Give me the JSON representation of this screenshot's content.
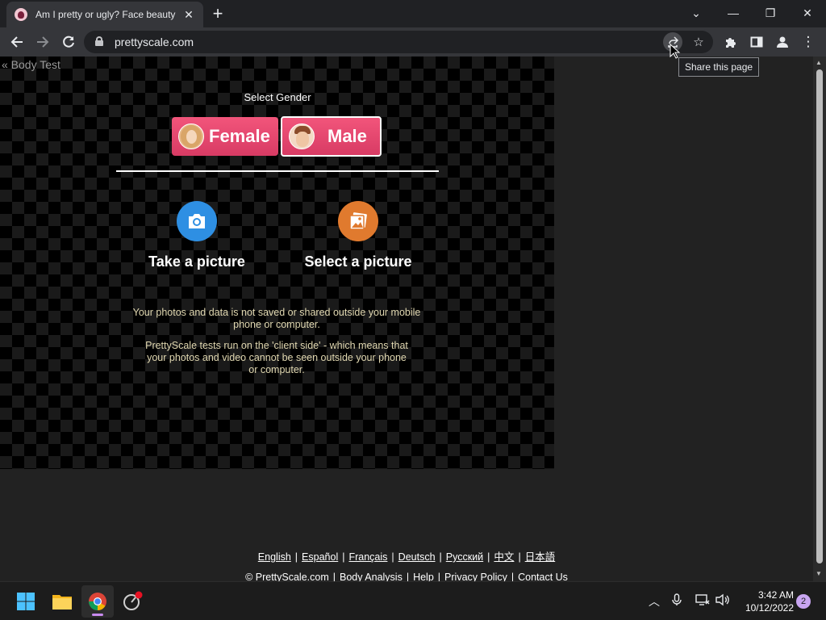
{
  "browser": {
    "tab_title": "Am I pretty or ugly? Face beauty",
    "tab_close": "✕",
    "new_tab": "+",
    "url": "prettyscale.com",
    "tooltip": "Share this page",
    "window": {
      "dropdown": "⌄",
      "minimize": "—",
      "restore": "❐",
      "close": "✕"
    }
  },
  "page": {
    "back_link": "« Body Test",
    "select_gender_label": "Select Gender",
    "gender_buttons": [
      {
        "label": "Female",
        "selected": false
      },
      {
        "label": "Male",
        "selected": true
      }
    ],
    "actions": [
      {
        "label": "Take a picture",
        "icon": "camera-icon",
        "color": "#2e8fe3"
      },
      {
        "label": "Select a picture",
        "icon": "photos-icon",
        "color": "#e07a2e"
      }
    ],
    "notice_1": "Your photos and data is not saved or shared outside your mobile phone or computer.",
    "notice_2": "PrettyScale tests run on the 'client side' - which means that your photos and video cannot be seen outside your phone or computer.",
    "languages": [
      "English",
      "Español",
      "Français",
      "Deutsch",
      "Русский",
      "中文",
      "日本語"
    ],
    "footer": [
      "© PrettyScale.com",
      "Body Analysis",
      "Help",
      "Privacy Policy",
      "Contact Us"
    ]
  },
  "taskbar": {
    "time": "3:42 AM",
    "date": "10/12/2022",
    "notifications": "2"
  },
  "colors": {
    "accent_pink": "#e8456e",
    "chrome_bg": "#202124"
  }
}
